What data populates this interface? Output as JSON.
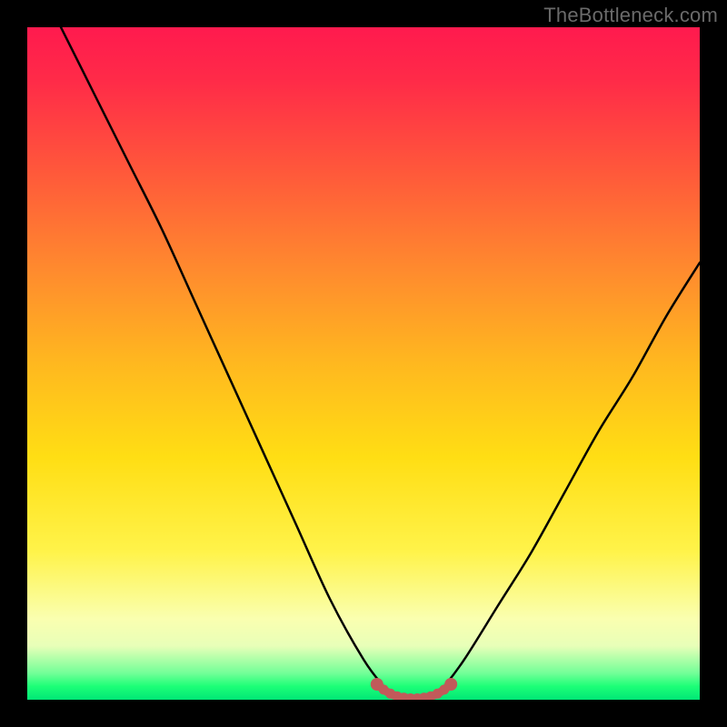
{
  "watermark": "TheBottleneck.com",
  "chart_data": {
    "type": "line",
    "title": "",
    "xlabel": "",
    "ylabel": "",
    "xlim": [
      0,
      100
    ],
    "ylim": [
      0,
      100
    ],
    "series": [
      {
        "name": "bottleneck-curve",
        "x": [
          5,
          10,
          15,
          20,
          25,
          30,
          35,
          40,
          45,
          50,
          53,
          55,
          58,
          60,
          62,
          65,
          70,
          75,
          80,
          85,
          90,
          95,
          100
        ],
        "values": [
          100,
          90,
          80,
          70,
          59,
          48,
          37,
          26,
          15,
          6,
          2,
          0,
          0,
          0,
          2,
          6,
          14,
          22,
          31,
          40,
          48,
          57,
          65
        ]
      }
    ],
    "markers": {
      "name": "optimal-range-dots",
      "color": "#c15a5a",
      "x": [
        52,
        53,
        54,
        55,
        56,
        57,
        58,
        59,
        60,
        61,
        62,
        63
      ],
      "values": [
        2.3,
        1.5,
        0.9,
        0.5,
        0.3,
        0.2,
        0.2,
        0.3,
        0.5,
        0.9,
        1.5,
        2.3
      ]
    },
    "annotations": []
  }
}
